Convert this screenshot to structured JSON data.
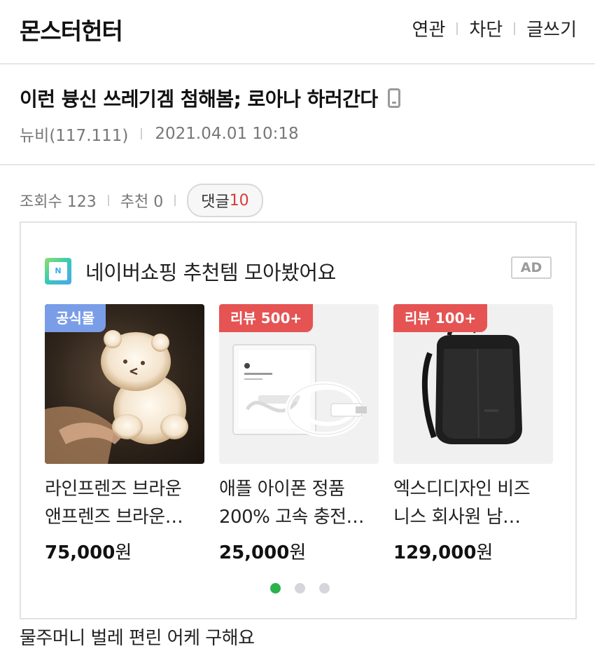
{
  "header": {
    "site_title": "몬스터헌터",
    "menu": [
      "연관",
      "차단",
      "글쓰기"
    ]
  },
  "post": {
    "title": "이런 븅신 쓰레기겜 첨해봄; 로아나 하러간다",
    "author": "뉴비(117.111)",
    "datetime": "2021.04.01 10:18",
    "views_label": "조회수 123",
    "recommend_label": "추천 0",
    "comments_label": "댓글",
    "comments_count": "10",
    "body": "물주머니 벌레 편린 어케 구해요"
  },
  "ad": {
    "logo_text": "N",
    "title": "네이버쇼핑 추천템 모아봤어요",
    "badge": "AD",
    "products": [
      {
        "badge": "공식몰",
        "name_line1": "라인프렌즈 브라운",
        "name_line2": "앤프렌즈 브라운…",
        "price": "75,000",
        "unit": "원"
      },
      {
        "badge": "리뷰 500+",
        "name_line1": "애플 아이폰 정품",
        "name_line2": "200% 고속 충전…",
        "price": "25,000",
        "unit": "원"
      },
      {
        "badge": "리뷰 100+",
        "name_line1": "엑스디디자인 비즈",
        "name_line2": "니스 회사원 남…",
        "price": "129,000",
        "unit": "원"
      }
    ],
    "carousel_page": 1,
    "carousel_total": 3
  },
  "colors": {
    "accent_red": "#d63c3c",
    "badge_blue": "#7a9de8",
    "badge_red": "#e55353",
    "dot_active": "#2bb24c"
  }
}
